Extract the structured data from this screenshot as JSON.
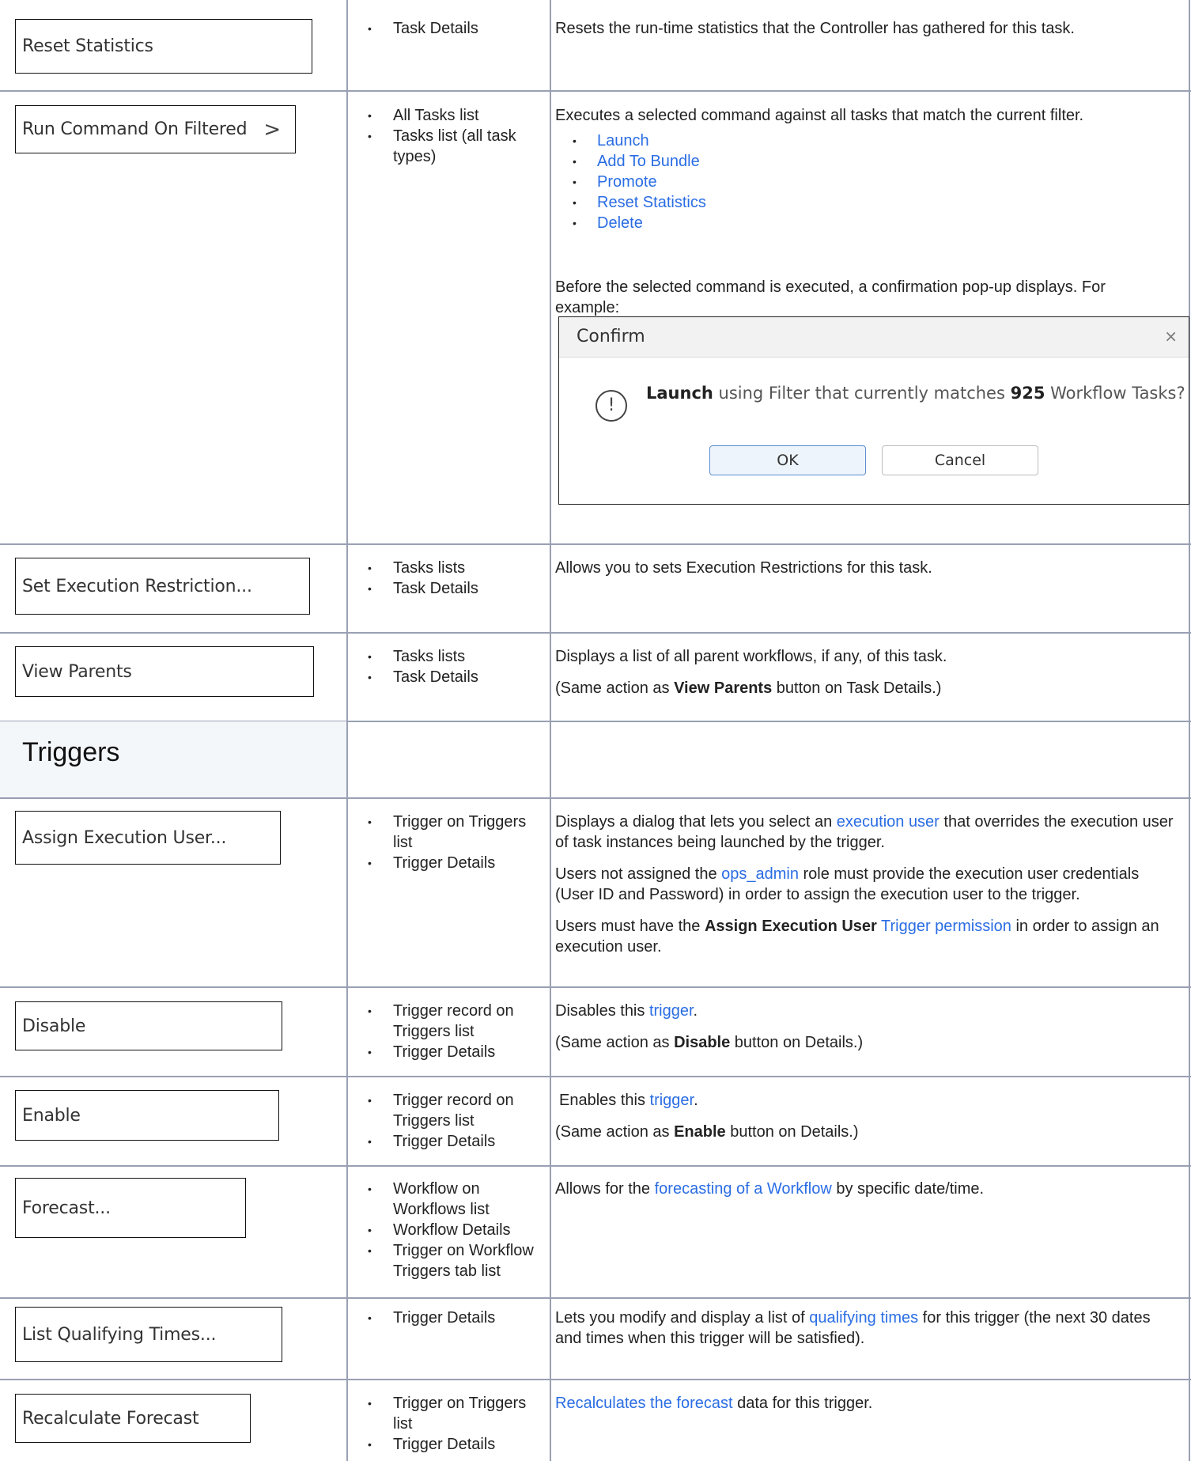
{
  "rows": {
    "reset_statistics": {
      "button": "Reset Statistics",
      "locations": [
        "Task Details"
      ],
      "description": "Resets the run-time statistics that the Controller has gathered for this task."
    },
    "run_command": {
      "button": "Run Command On Filtered",
      "chevron": ">",
      "locations": [
        "All Tasks list",
        "Tasks list (all task types)"
      ],
      "description": "Executes a selected command against all tasks that match the current filter.",
      "commands": [
        "Launch",
        "Add To Bundle",
        "Promote",
        "Reset Statistics",
        "Delete"
      ],
      "note": "Before the selected command is executed, a confirmation pop-up displays. For example:"
    },
    "set_execution_restriction": {
      "button": "Set Execution Restriction...",
      "locations": [
        "Tasks lists",
        "Task Details"
      ],
      "description": "Allows you to sets Execution Restrictions for this task."
    },
    "view_parents": {
      "button": "View Parents",
      "locations": [
        "Tasks lists",
        "Task Details"
      ],
      "description": "Displays a list of all parent workflows, if any, of this task.",
      "note_prefix": "(Same action as ",
      "note_bold": "View Parents",
      "note_suffix": " button on Task Details.)"
    },
    "triggers_section": {
      "title": "Triggers"
    },
    "assign_execution_user": {
      "button": "Assign Execution User...",
      "locations": [
        "Trigger on Triggers list",
        "Trigger Details"
      ],
      "p1_prefix": "Displays a dialog that lets you select an ",
      "p1_link": "execution user",
      "p1_suffix": " that overrides the execution user of task instances being launched by the trigger.",
      "p2_prefix": "Users not assigned the ",
      "p2_link": "ops_admin",
      "p2_suffix": " role must provide the execution user credentials (User ID and Password) in order to assign the execution user to the trigger.",
      "p3_prefix": "Users must have the ",
      "p3_bold": "Assign Execution User",
      "p3_link": "Trigger permission",
      "p3_suffix": " in order to assign an execution user."
    },
    "disable": {
      "button": "Disable",
      "locations": [
        "Trigger record on Triggers list",
        "Trigger Details"
      ],
      "p1_prefix": "Disables this ",
      "p1_link": "trigger",
      "p1_suffix": ".",
      "note_prefix": "(Same action as ",
      "note_bold": "Disable",
      "note_suffix": " button on Details.)"
    },
    "enable": {
      "button": "Enable",
      "locations": [
        "Trigger record on Triggers list",
        "Trigger Details"
      ],
      "p1_prefix": "Enables this ",
      "p1_link": "trigger",
      "p1_suffix": ".",
      "note_prefix": "(Same action as ",
      "note_bold": "Enable",
      "note_suffix": " button on Details.)"
    },
    "forecast": {
      "button": "Forecast...",
      "locations": [
        "Workflow on Workflows list",
        "Workflow Details",
        "Trigger on Workflow Triggers tab list"
      ],
      "p1_prefix": "Allows for the ",
      "p1_link": "forecasting of a Workflow",
      "p1_suffix": " by specific date/time."
    },
    "list_qualifying_times": {
      "button": "List Qualifying Times...",
      "locations": [
        "Trigger Details"
      ],
      "p1_prefix": "Lets you modify and display a list of ",
      "p1_link": "qualifying times",
      "p1_suffix": " for this trigger (the next 30 dates and times when this trigger will be satisfied)."
    },
    "recalculate_forecast": {
      "button": "Recalculate Forecast",
      "locations": [
        "Trigger on Triggers list",
        "Trigger Details"
      ],
      "p1_link": "Recalculates the forecast",
      "p1_suffix": " data for this trigger."
    }
  },
  "dialog": {
    "title": "Confirm",
    "close": "×",
    "icon": "!",
    "msg_bold1": "Launch",
    "msg_mid": " using Filter that currently matches ",
    "msg_bold2": "925",
    "msg_end": " Workflow Tasks?",
    "ok": "OK",
    "cancel": "Cancel"
  }
}
